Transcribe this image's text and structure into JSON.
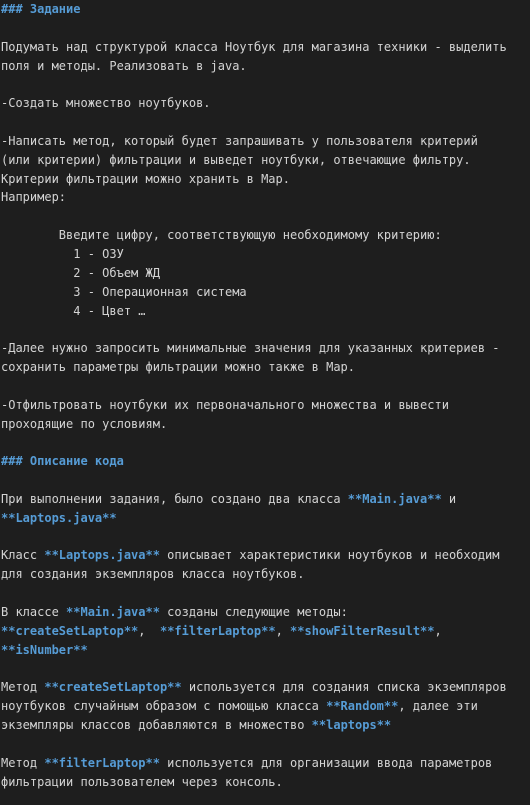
{
  "colors": {
    "background": "#1e1e1e",
    "text": "#d4d4d4",
    "markdown_accent": "#569cd6"
  },
  "lines": [
    [
      {
        "s": "h",
        "t": "### Задание"
      }
    ],
    [],
    [
      {
        "s": "t",
        "t": "Подумать над структурой класса Ноутбук для магазина техники - выделить"
      }
    ],
    [
      {
        "s": "t",
        "t": "поля и методы. Реализовать в java."
      }
    ],
    [],
    [
      {
        "s": "t",
        "t": "-Создать множество ноутбуков."
      }
    ],
    [],
    [
      {
        "s": "t",
        "t": "-Написать метод, который будет запрашивать у пользователя критерий"
      }
    ],
    [
      {
        "s": "t",
        "t": "(или критерии) фильтрации и выведет ноутбуки, отвечающие фильтру."
      }
    ],
    [
      {
        "s": "t",
        "t": "Критерии фильтрации можно хранить в Map."
      }
    ],
    [
      {
        "s": "t",
        "t": "Например:"
      }
    ],
    [],
    [
      {
        "s": "t",
        "t": "        Введите цифру, соответствующую необходимому критерию:"
      }
    ],
    [
      {
        "s": "t",
        "t": "          1 - ОЗУ"
      }
    ],
    [
      {
        "s": "t",
        "t": "          2 - Объем ЖД"
      }
    ],
    [
      {
        "s": "t",
        "t": "          3 - Операционная система"
      }
    ],
    [
      {
        "s": "t",
        "t": "          4 - Цвет …"
      }
    ],
    [],
    [
      {
        "s": "t",
        "t": "-Далее нужно запросить минимальные значения для указанных критериев -"
      }
    ],
    [
      {
        "s": "t",
        "t": "сохранить параметры фильтрации можно также в Map."
      }
    ],
    [],
    [
      {
        "s": "t",
        "t": "-Отфильтровать ноутбуки их первоначального множества и вывести"
      }
    ],
    [
      {
        "s": "t",
        "t": "проходящие по условиям."
      }
    ],
    [],
    [
      {
        "s": "h",
        "t": "### Описание кода"
      }
    ],
    [],
    [
      {
        "s": "t",
        "t": "При выполнении задания, было создано два класса "
      },
      {
        "s": "b",
        "t": "**Main.java**"
      },
      {
        "s": "t",
        "t": " и"
      }
    ],
    [
      {
        "s": "b",
        "t": "**Laptops.java**"
      }
    ],
    [],
    [
      {
        "s": "t",
        "t": "Класс "
      },
      {
        "s": "b",
        "t": "**Laptops.java**"
      },
      {
        "s": "t",
        "t": " описывает характеристики ноутбуков и необходим"
      }
    ],
    [
      {
        "s": "t",
        "t": "для создания экземпляров класса ноутбуков."
      }
    ],
    [],
    [
      {
        "s": "t",
        "t": "В классе "
      },
      {
        "s": "b",
        "t": "**Main.java**"
      },
      {
        "s": "t",
        "t": " созданы следующие методы:"
      }
    ],
    [
      {
        "s": "b",
        "t": "**createSetLaptop**"
      },
      {
        "s": "t",
        "t": ",  "
      },
      {
        "s": "b",
        "t": "**filterLaptop**"
      },
      {
        "s": "t",
        "t": ", "
      },
      {
        "s": "b",
        "t": "**showFilterResult**"
      },
      {
        "s": "t",
        "t": ","
      }
    ],
    [
      {
        "s": "b",
        "t": "**isNumber**"
      }
    ],
    [],
    [
      {
        "s": "t",
        "t": "Метод "
      },
      {
        "s": "b",
        "t": "**createSetLaptop**"
      },
      {
        "s": "t",
        "t": " используется для создания списка экземпляров"
      }
    ],
    [
      {
        "s": "t",
        "t": "ноутбуков случайным образом с помощью класса "
      },
      {
        "s": "b",
        "t": "**Random**"
      },
      {
        "s": "t",
        "t": ", далее эти"
      }
    ],
    [
      {
        "s": "t",
        "t": "экземпляры классов добавляются в множество "
      },
      {
        "s": "b",
        "t": "**laptops**"
      }
    ],
    [],
    [
      {
        "s": "t",
        "t": "Метод "
      },
      {
        "s": "b",
        "t": "**filterLaptop**"
      },
      {
        "s": "t",
        "t": " используется для организации ввода параметров"
      }
    ],
    [
      {
        "s": "t",
        "t": "фильтрации пользователем через консоль."
      }
    ]
  ]
}
